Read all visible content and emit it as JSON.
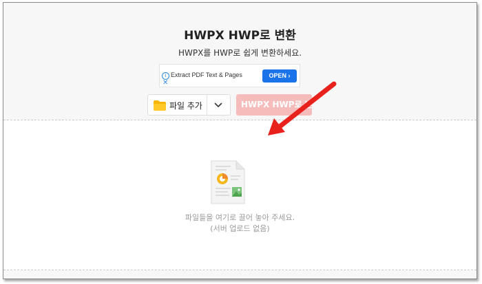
{
  "page": {
    "title": "HWPX HWP로 변환",
    "subtitle": "HWPX를 HWP로 쉽게 변환하세요."
  },
  "ad": {
    "info_icon": "info-icon",
    "info_glyph": "i",
    "close_glyph": "✕",
    "text": "Extract PDF Text & Pages",
    "button_label": "OPEN ›"
  },
  "toolbar": {
    "file_add_label": "파일 추가",
    "folder_icon": "folder-icon",
    "dropdown_icon": "chevron-down-icon",
    "convert_label": "HWPX HWP로 변환",
    "convert_color": "#f6bcbc"
  },
  "dropzone": {
    "icon": "document-icon",
    "text": "파일들을 여기로 끌어 놓아 주세요.",
    "subtext": "(서버 업로드 없음)"
  },
  "annotation": {
    "arrow_color": "#e8211d"
  }
}
